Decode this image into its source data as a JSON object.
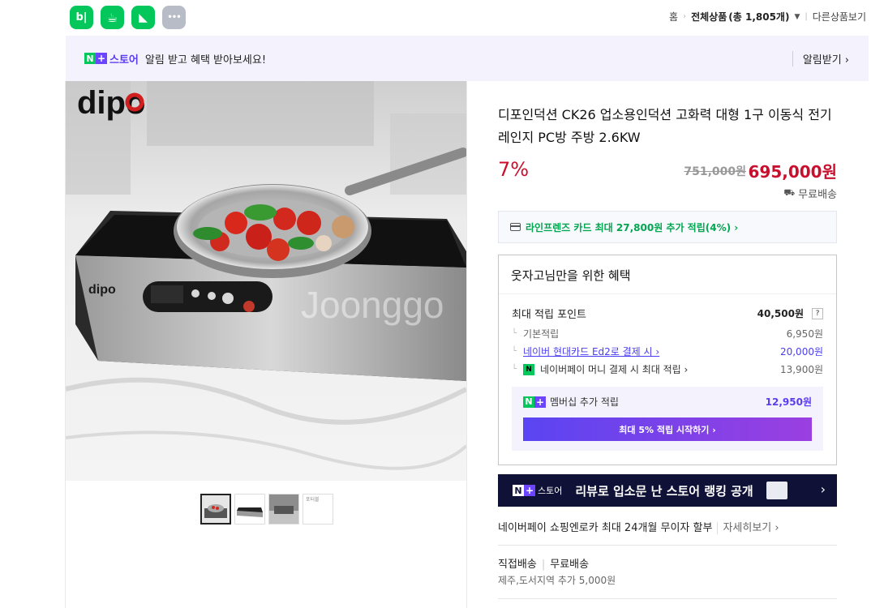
{
  "topbar": {
    "apps": [
      {
        "name": "blog",
        "glyph": "b|"
      },
      {
        "name": "cafe",
        "glyph": "☕"
      },
      {
        "name": "bookmark",
        "glyph": "◣"
      },
      {
        "name": "more",
        "glyph": "•••"
      }
    ],
    "breadcrumb": {
      "home": "홈",
      "all": "전체상품",
      "count": "(총 1,805개)",
      "other": "다른상품보기"
    }
  },
  "banner": {
    "store": "스토어",
    "message": "알림 받고 혜택 받아보세요!",
    "action": "알림받기"
  },
  "product": {
    "title": "디포인덕션 CK26 업소용인덕션 고화력 대형 1구 이동식 전기레인지 PC방 주방 2.6KW",
    "discount": "7%",
    "original_price": "751,000원",
    "price": "695,000원",
    "shipping": "무료배송",
    "brand_logo": "dipo",
    "watermark": "Joonggo",
    "thumb4_text": "포터블"
  },
  "card_offer": "라인프렌즈 카드 최대 27,800원 추가 적립(4%) ›",
  "benefit": {
    "title": "웃자고님만을 위한 혜택",
    "max_label": "최대 적립 포인트",
    "max_value": "40,500원",
    "help": "?",
    "rows": [
      {
        "label": "기본적립",
        "value": "6,950원"
      },
      {
        "label": "네이버 현대카드 Ed2로 결제 시 ›",
        "value": "20,000원"
      },
      {
        "label": "네이버페이 머니 결제 시 최대 적립 ›",
        "value": "13,900원"
      }
    ],
    "membership_label": "멤버십 추가 적립",
    "membership_value": "12,950원",
    "membership_button": "최대 5% 적립 시작하기 ›"
  },
  "rank_banner": {
    "store": "스토어",
    "text": "리뷰로 입소문 난 스토어 랭킹 공개"
  },
  "installment": {
    "text": "네이버페이 쇼핑엔로카 최대 24개월 무이자 할부",
    "more": "자세히보기 ›"
  },
  "delivery": {
    "type": "직접배송",
    "fee": "무료배송",
    "extra": "제주,도서지역 추가 5,000원"
  },
  "colors": {
    "naver_green": "#03c75a",
    "price_red": "#c8102e",
    "store_purple": "#5b3cf0"
  }
}
